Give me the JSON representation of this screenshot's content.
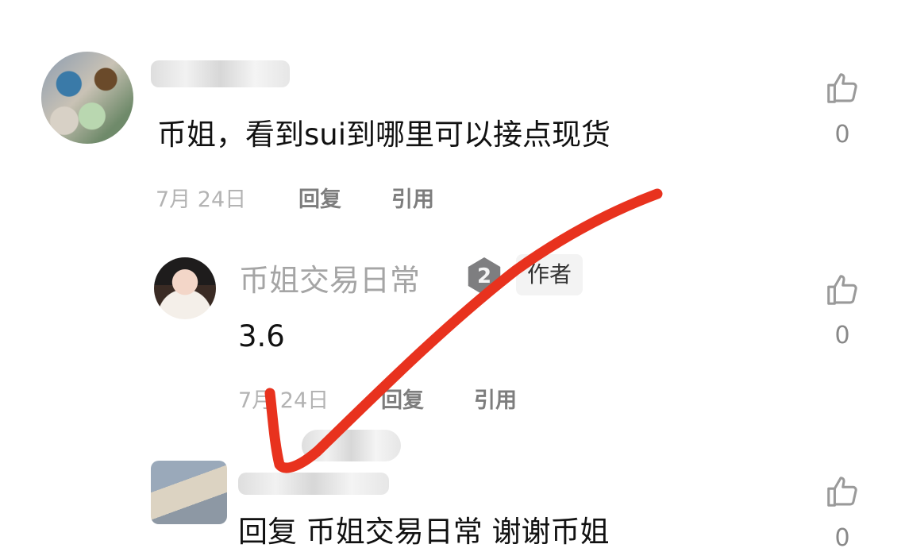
{
  "comments": [
    {
      "text": "币姐，看到sui到哪里可以接点现货",
      "date": "7月 24日",
      "reply_label": "回复",
      "quote_label": "引用",
      "likes": "0"
    },
    {
      "username": "币姐交易日常",
      "level": "2",
      "author_tag": "作者",
      "text": "3.6",
      "date": "7月 24日",
      "reply_label": "回复",
      "quote_label": "引用",
      "likes": "0"
    },
    {
      "text": "回复 币姐交易日常 谢谢币姐",
      "likes": "0"
    }
  ],
  "icons": {
    "like": "thumbs-up-icon"
  },
  "colors": {
    "annotation_check": "#e8321e",
    "meta_gray": "#b3b3b3",
    "action_gray": "#7d7d7d"
  }
}
